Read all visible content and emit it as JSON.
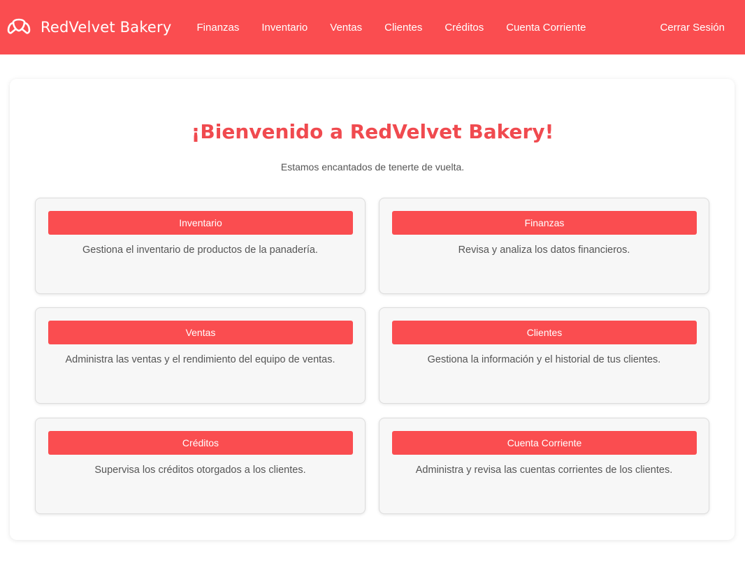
{
  "brand": {
    "name": "RedVelvet Bakery",
    "logo_icon": "croissant-icon"
  },
  "nav": {
    "links": [
      "Finanzas",
      "Inventario",
      "Ventas",
      "Clientes",
      "Créditos",
      "Cuenta Corriente"
    ],
    "logout_label": "Cerrar Sesión"
  },
  "main": {
    "title": "¡Bienvenido a RedVelvet Bakery!",
    "subtitle": "Estamos encantados de tenerte de vuelta.",
    "cards": [
      {
        "button": "Inventario",
        "text": "Gestiona el inventario de productos de la panadería."
      },
      {
        "button": "Finanzas",
        "text": "Revisa y analiza los datos financieros."
      },
      {
        "button": "Ventas",
        "text": "Administra las ventas y el rendimiento del equipo de ventas."
      },
      {
        "button": "Clientes",
        "text": "Gestiona la información y el historial de tus clientes."
      },
      {
        "button": "Créditos",
        "text": "Supervisa los créditos otorgados a los clientes."
      },
      {
        "button": "Cuenta Corriente",
        "text": "Administra y revisa las cuentas corrientes de los clientes."
      }
    ]
  },
  "colors": {
    "accent": "#fa4d50",
    "title": "#f04a4f",
    "card_bg": "#f7f7f7"
  }
}
